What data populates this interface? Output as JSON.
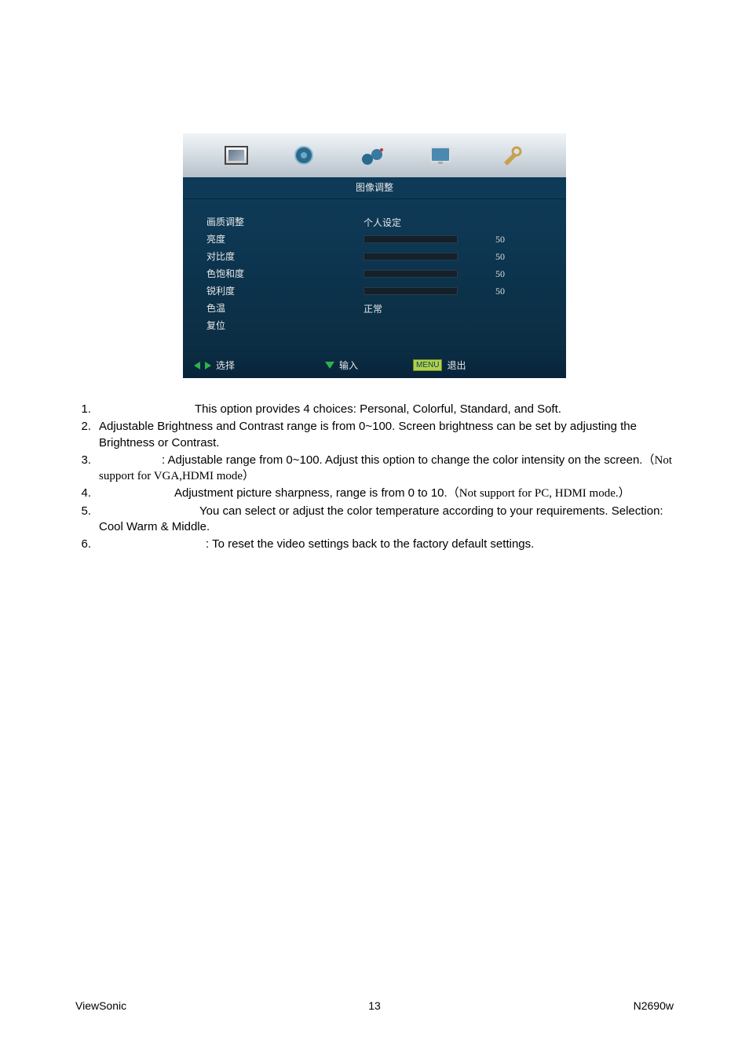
{
  "osd": {
    "title": "图像调整",
    "labels": {
      "picture_mode": "画质调整",
      "brightness": "亮度",
      "contrast": "对比度",
      "saturation": "色饱和度",
      "sharpness": "锐利度",
      "color_temp": "色温",
      "reset": "复位"
    },
    "values": {
      "picture_mode": "个人设定",
      "brightness": "50",
      "contrast": "50",
      "saturation": "50",
      "sharpness": "50",
      "color_temp": "正常"
    },
    "footer": {
      "select": "选择",
      "enter": "输入",
      "menu": "MENU",
      "exit": "退出"
    }
  },
  "list": {
    "i1": "This option provides 4 choices: Personal, Colorful, Standard, and Soft.",
    "i2": "Adjustable Brightness and Contrast range is from 0~100. Screen brightness can be set by adjusting the Brightness or Contrast.",
    "i3a": ": Adjustable range from 0~100. Adjust this option to change the color intensity on the screen.",
    "i3b": "（Not support for VGA,HDMI mode）",
    "i4a": "Adjustment picture sharpness, range is from 0 to 10.",
    "i4b": "（Not support for PC, HDMI mode.）",
    "i5": "You can select or adjust the color temperature according to your requirements. Selection: Cool Warm & Middle.",
    "i6": ": To reset the video settings back to the factory default settings."
  },
  "footer": {
    "left": "ViewSonic",
    "center": "13",
    "right": "N2690w"
  }
}
